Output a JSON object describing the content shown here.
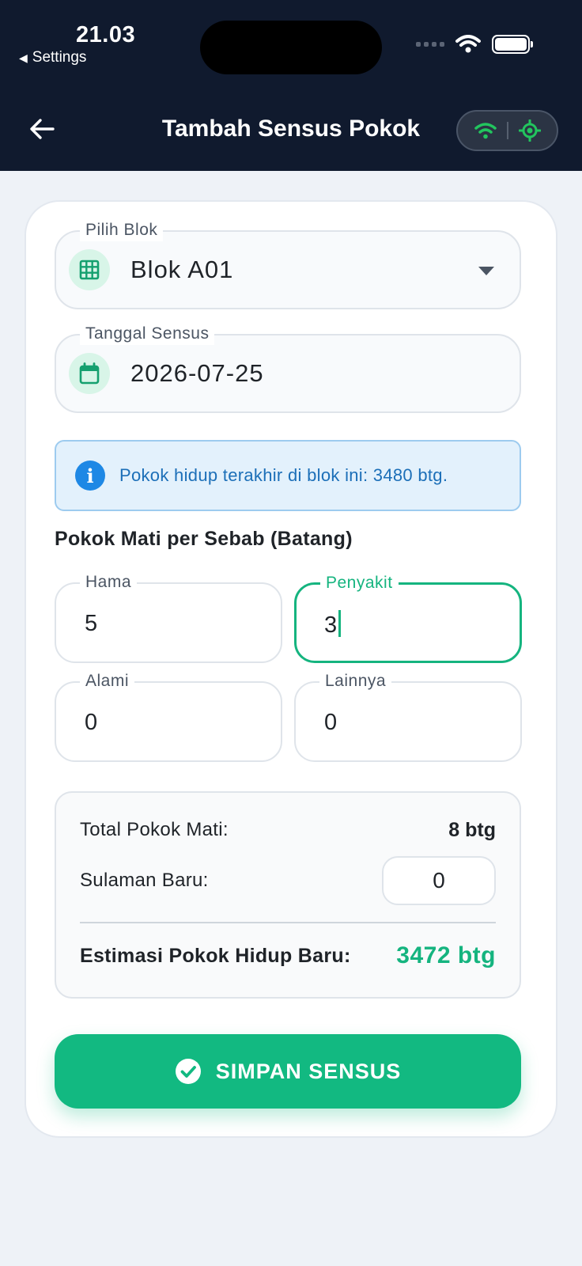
{
  "status_bar": {
    "time": "21.03",
    "back_app": "Settings"
  },
  "header": {
    "title": "Tambah Sensus Pokok",
    "back_icon": "arrow-left-icon",
    "connectivity_icons": [
      "wifi-icon",
      "gps-icon"
    ],
    "accent_color": "#22c55e"
  },
  "form": {
    "block": {
      "label": "Pilih Blok",
      "value": "Blok A01",
      "icon": "grid-icon"
    },
    "date": {
      "label": "Tanggal Sensus",
      "value": "2026-07-25",
      "icon": "calendar-icon"
    },
    "info": {
      "text": "Pokok hidup terakhir di blok ini: 3480 btg.",
      "icon": "info-icon"
    },
    "dead_section_title": "Pokok Mati per Sebab (Batang)",
    "causes": {
      "hama": {
        "label": "Hama",
        "value": "5"
      },
      "penyakit": {
        "label": "Penyakit",
        "value": "3"
      },
      "alami": {
        "label": "Alami",
        "value": "0"
      },
      "lainnya": {
        "label": "Lainnya",
        "value": "0"
      }
    }
  },
  "summary": {
    "total_label": "Total Pokok Mati:",
    "total_value": "8 btg",
    "sulaman_label": "Sulaman Baru:",
    "sulaman_value": "0",
    "estimate_label": "Estimasi Pokok Hidup Baru:",
    "estimate_value": "3472 btg"
  },
  "save_button": {
    "label": "SIMPAN SENSUS",
    "icon": "check-circle-icon",
    "color": "#12b981"
  }
}
